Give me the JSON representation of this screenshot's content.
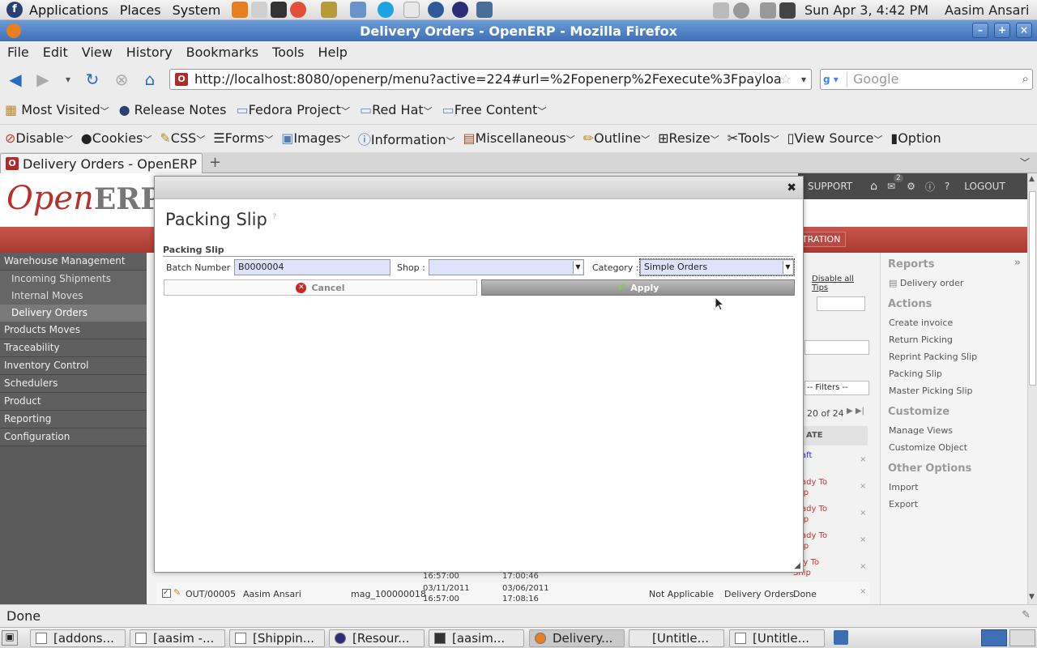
{
  "gnome": {
    "menus": [
      "Applications",
      "Places",
      "System"
    ],
    "clock": "Sun Apr  3,  4:42 PM",
    "user": "Aasim Ansari"
  },
  "window": {
    "title": "Delivery Orders - OpenERP - Mozilla Firefox"
  },
  "menubar": [
    "File",
    "Edit",
    "View",
    "History",
    "Bookmarks",
    "Tools",
    "Help"
  ],
  "nav": {
    "url": "http://localhost:8080/openerp/menu?active=224#url=%2Fopenerp%2Fexecute%3Fpayloa",
    "search_placeholder": "Google"
  },
  "bookmarks": [
    "Most Visited",
    "Release Notes",
    "Fedora Project",
    "Red Hat",
    "Free Content"
  ],
  "devtools": [
    "Disable",
    "Cookies",
    "CSS",
    "Forms",
    "Images",
    "Information",
    "Miscellaneous",
    "Outline",
    "Resize",
    "Tools",
    "View Source",
    "Option"
  ],
  "tab": {
    "title": "Delivery Orders - OpenERP"
  },
  "openerp": {
    "logo_a": "Open",
    "logo_b": "ERP",
    "support": "SUPPORT",
    "logout": "LOGOUT",
    "notif_count": "2",
    "admin_frag": "TRATION",
    "sidebar": {
      "root": "Warehouse Management",
      "subs": [
        "Incoming Shipments",
        "Internal Moves",
        "Delivery Orders"
      ],
      "items": [
        "Products Moves",
        "Traceability",
        "Inventory Control",
        "Schedulers",
        "Product",
        "Reporting",
        "Configuration"
      ]
    },
    "grid": {
      "disable_tips": "Disable all Tips",
      "filters": "-- Filters --",
      "paging": "20 of 24",
      "col_state_frag": "ATE",
      "state_frags": [
        "aft",
        "ady To",
        "ady To",
        "ady To",
        "ady To"
      ],
      "state_frags2": [
        "",
        "ip",
        "ip",
        "ip",
        "Ship"
      ],
      "partial_dates": [
        "16:57:00",
        "17:00:46"
      ],
      "last_row": {
        "ref": "OUT/00005",
        "partner": "Aasim Ansari",
        "origin": "mag_100000018",
        "date1": "03/11/2011",
        "time1": "16:57:00",
        "date2": "03/06/2011",
        "time2": "17:08:16",
        "invoice": "Not Applicable",
        "type": "Delivery Orders",
        "state": "Done"
      }
    },
    "right_panel": {
      "reports_title": "Reports",
      "reports": [
        "Delivery order"
      ],
      "actions_title": "Actions",
      "actions": [
        "Create invoice",
        "Return Picking",
        "Reprint Packing Slip",
        "Packing Slip",
        "Master Picking Slip"
      ],
      "customize_title": "Customize",
      "customize": [
        "Manage Views",
        "Customize Object"
      ],
      "other_title": "Other Options",
      "other": [
        "Import",
        "Export"
      ]
    }
  },
  "modal": {
    "title": "Packing Slip",
    "section": "Packing Slip",
    "batch_label": "Batch Number :",
    "batch_value": "B0000004",
    "shop_label": "Shop :",
    "shop_value": "",
    "category_label": "Category :",
    "category_value": "Simple Orders",
    "cancel": "Cancel",
    "apply": "Apply"
  },
  "status": "Done",
  "taskbar": [
    "[addons...",
    "[aasim -...",
    "[Shippin...",
    "[Resour...",
    "[aasim...",
    "Delivery...",
    "[Untitle...",
    "[Untitle..."
  ],
  "colors": {
    "brand_red": "#b5312c",
    "title_blue": "#3f6fb5",
    "field_bg": "#dde3fb"
  }
}
